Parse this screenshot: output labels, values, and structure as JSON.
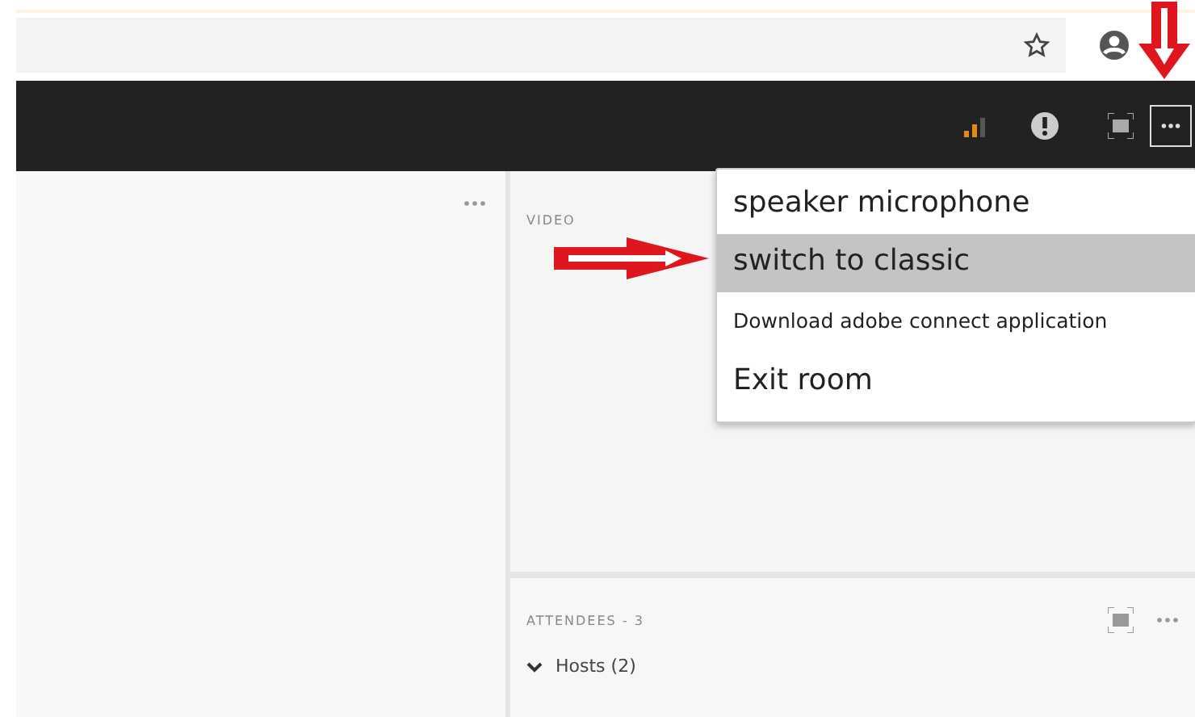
{
  "menu": {
    "items": [
      {
        "label": "speaker microphone",
        "kind": "large",
        "selected": false
      },
      {
        "label": "switch to classic",
        "kind": "large",
        "selected": true
      },
      {
        "label": "Download adobe connect application",
        "kind": "small",
        "selected": false
      },
      {
        "label": "Exit room",
        "kind": "large",
        "selected": false
      }
    ]
  },
  "video_pod": {
    "title": "VIDEO"
  },
  "attendees_pod": {
    "title": "ATTENDEES - 3",
    "groups": [
      {
        "label": "Hosts (2)",
        "expanded": true
      }
    ]
  }
}
